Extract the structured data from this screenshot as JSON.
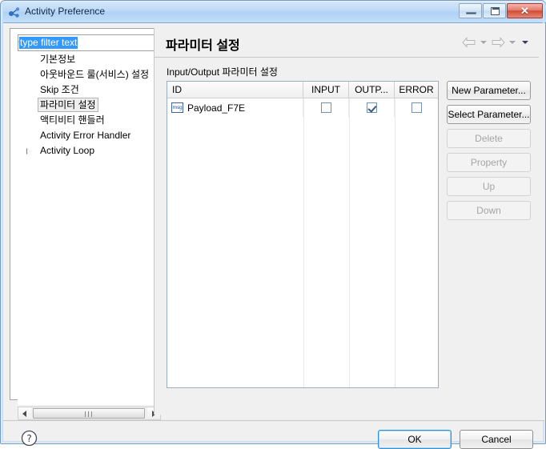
{
  "window": {
    "title": "Activity Preference",
    "app_icon": "molecule-icon",
    "controls": {
      "minimize": "minimize-icon",
      "restore": "restore-icon",
      "close": "✕"
    }
  },
  "sidebar": {
    "filter": {
      "value": "type filter text",
      "placeholder": "type filter text",
      "selected": true
    },
    "items": [
      {
        "label": "기본정보",
        "expandable": false,
        "selected": false
      },
      {
        "label": "아웃바운드 룰(서비스) 설정",
        "expandable": false,
        "selected": false
      },
      {
        "label": "Skip 조건",
        "expandable": false,
        "selected": false
      },
      {
        "label": "파라미터 설정",
        "expandable": false,
        "selected": true
      },
      {
        "label": "액티비티 핸들러",
        "expandable": false,
        "selected": false
      },
      {
        "label": "Activity Error Handler",
        "expandable": false,
        "selected": false
      },
      {
        "label": "Activity Loop",
        "expandable": true,
        "selected": false
      }
    ],
    "scrollbar": {
      "left_arrow": "scroll-left-icon",
      "right_arrow": "scroll-right-icon"
    }
  },
  "content": {
    "title": "파라미터 설정",
    "group_label": "Input/Output 파라미터 설정",
    "nav": {
      "back": "back-arrow-icon",
      "back_menu": "chevron-down-icon",
      "forward": "forward-arrow-icon",
      "forward_menu": "chevron-down-icon",
      "view_menu": "chevron-down-icon"
    },
    "table": {
      "columns": [
        "ID",
        "INPUT",
        "OUTP...",
        "ERROR"
      ],
      "rows": [
        {
          "icon": "msg-icon",
          "icon_label": "msg",
          "id": "Payload_F7E",
          "input": false,
          "output": true,
          "error": false
        }
      ]
    },
    "buttons": [
      {
        "label": "New Parameter...",
        "enabled": true
      },
      {
        "label": "Select Parameter...",
        "enabled": true
      },
      {
        "label": "Delete",
        "enabled": false
      },
      {
        "label": "Property",
        "enabled": false
      },
      {
        "label": "Up",
        "enabled": false
      },
      {
        "label": "Down",
        "enabled": false
      }
    ]
  },
  "footer": {
    "help": "help-icon",
    "ok_label": "OK",
    "cancel_label": "Cancel"
  },
  "colors": {
    "titlebar": "#bcd9f7",
    "selection": "#3399ff",
    "dialog_bg": "#f0f0f0",
    "close_button": "#d24b33",
    "default_button_focus": "#2f93d6"
  }
}
